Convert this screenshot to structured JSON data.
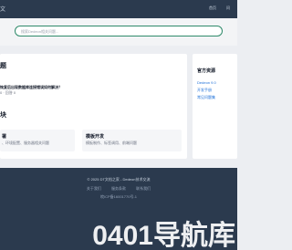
{
  "header": {
    "brand": "文",
    "nav": [
      {
        "label": "首页"
      },
      {
        "label": "问"
      }
    ]
  },
  "search": {
    "placeholder": "搜索Dedeon相关问题..."
  },
  "main": {
    "qa_section_title": "题",
    "question": {
      "title": "恢复后出现数据库连接错误如何解决？",
      "meta": "0 · 回答 0"
    },
    "modules_section_title": "块",
    "modules": [
      {
        "title": "署",
        "desc": "、环境配置、服务器相关问题"
      },
      {
        "title": "模板开发",
        "desc": "模板制作、标签调用、前端问题"
      }
    ]
  },
  "sidebar": {
    "title": "官方资源",
    "links": [
      {
        "label": "Dedeon 9.0"
      },
      {
        "label": "开发手册"
      },
      {
        "label": "常见问题集"
      }
    ]
  },
  "footer": {
    "copyright": "© 2025 DT文档之家 - Dedeon技术交流",
    "links": [
      {
        "label": "关于我们"
      },
      {
        "label": "服务条款"
      },
      {
        "label": "联系我们"
      }
    ],
    "icp": "皖ICP备16001770号-1"
  },
  "watermark": {
    "text": "0401导航库"
  },
  "colors": {
    "header_bg": "#2b3a4e",
    "accent_green": "#2f8a6a",
    "link_blue": "#1d6fd8",
    "page_bg": "#eceef2"
  }
}
